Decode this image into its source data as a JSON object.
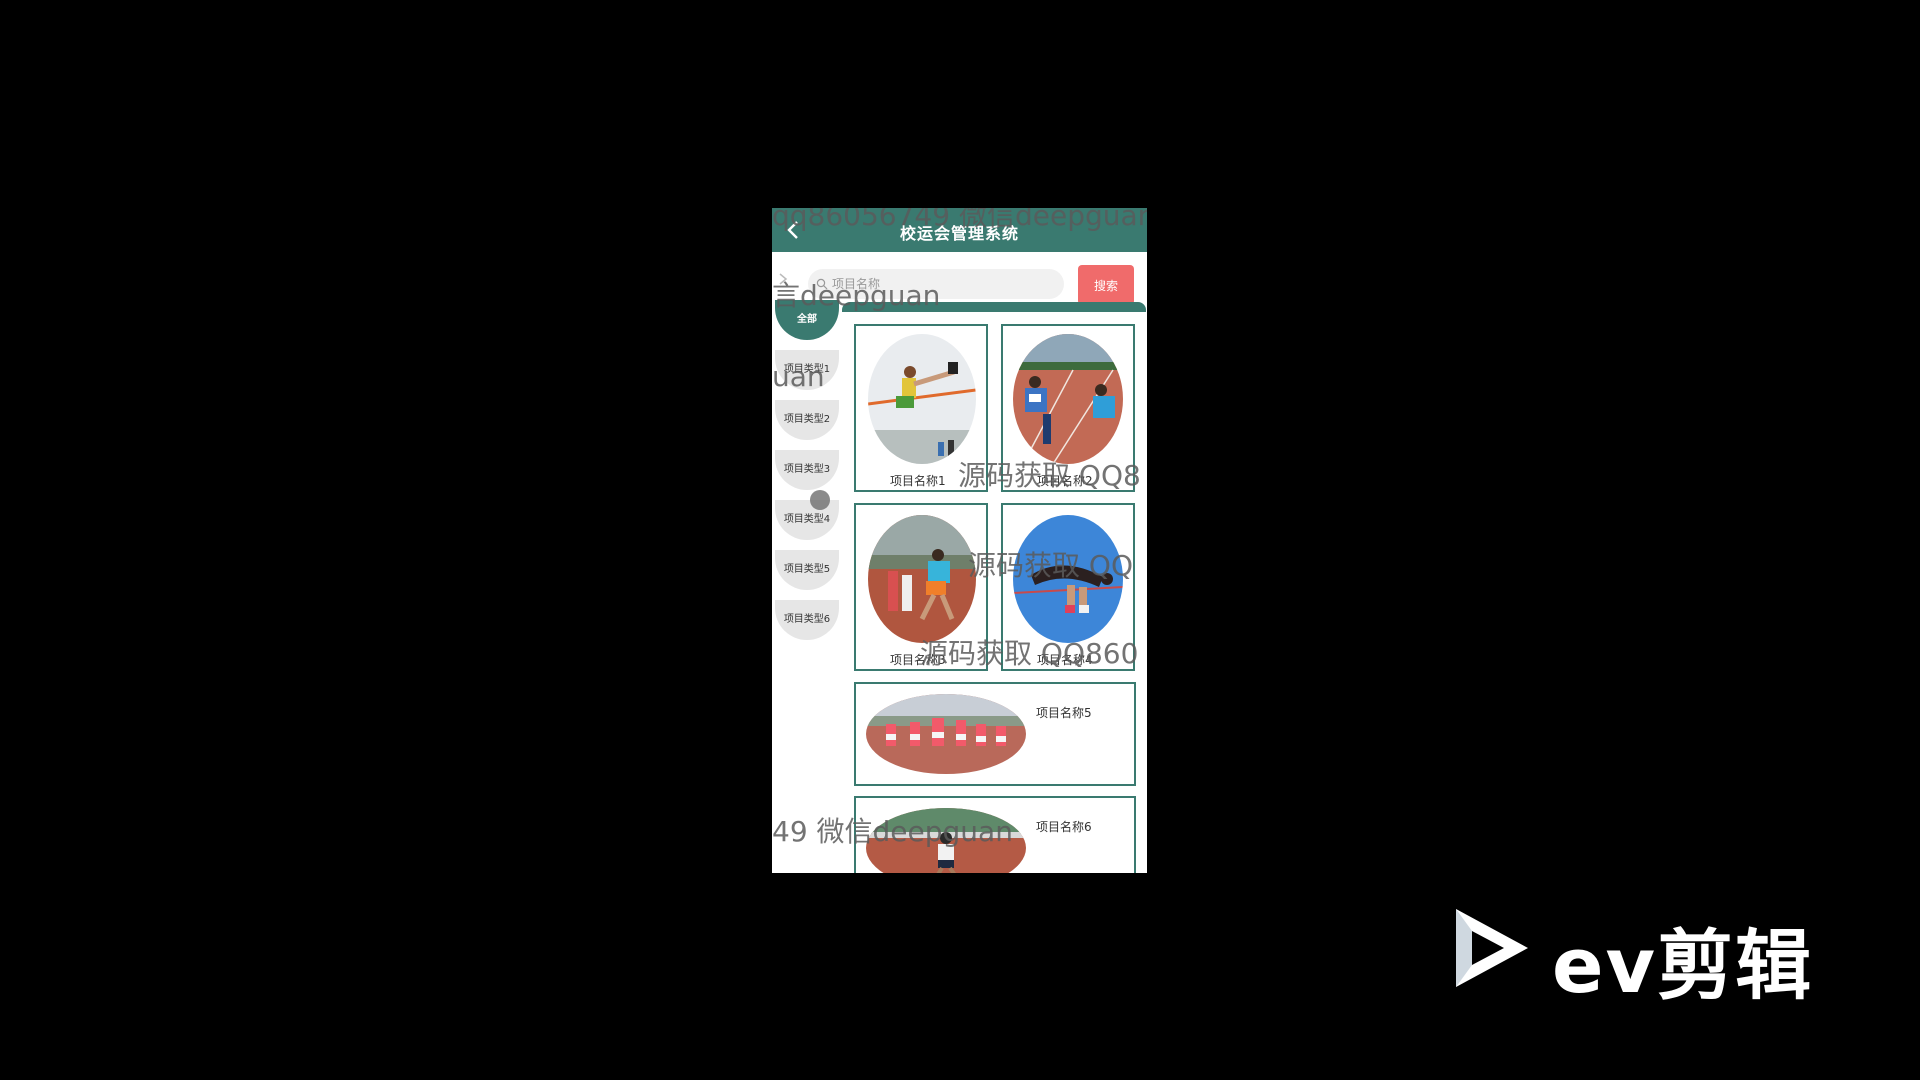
{
  "app": {
    "title": "校运会管理系统",
    "back_icon": "back-arrow-icon"
  },
  "search": {
    "placeholder": "项目名称",
    "value": "",
    "button_label": "搜索"
  },
  "categories": [
    {
      "label": "全部",
      "active": true
    },
    {
      "label": "项目类型1",
      "active": false
    },
    {
      "label": "项目类型2",
      "active": false
    },
    {
      "label": "项目类型3",
      "active": false
    },
    {
      "label": "项目类型4",
      "active": false
    },
    {
      "label": "项目类型5",
      "active": false
    },
    {
      "label": "项目类型6",
      "active": false
    }
  ],
  "items": [
    {
      "title": "项目名称1"
    },
    {
      "title": "项目名称2"
    },
    {
      "title": "项目名称3"
    },
    {
      "title": "项目名称4"
    },
    {
      "title": "项目名称5"
    },
    {
      "title": "项目名称6"
    }
  ],
  "watermarks": [
    "qq86056749 微信deepguan",
    "言deepguan",
    "uan",
    "源码获取 QQ8",
    "源码获取 QQ",
    "源码获取 QQ860",
    "49 微信deepguan"
  ],
  "player_brand": {
    "name": "ev剪辑",
    "icon": "play-triangle-icon"
  },
  "colors": {
    "accent": "#3a7a70",
    "search_button": "#f06b6b",
    "background": "#000000"
  }
}
